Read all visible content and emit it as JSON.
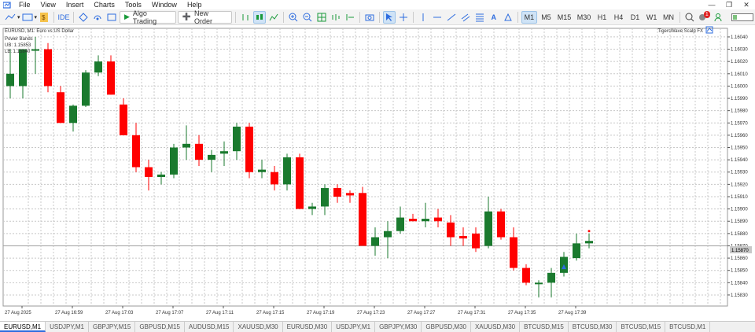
{
  "menu": {
    "items": [
      "File",
      "View",
      "Insert",
      "Charts",
      "Tools",
      "Window",
      "Help"
    ]
  },
  "toolbar": {
    "ide": "IDE",
    "algo_trading": "Algo Trading",
    "new_order": "New Order",
    "timeframes": [
      "M1",
      "M5",
      "M15",
      "M30",
      "H1",
      "H4",
      "D1",
      "W1",
      "MN"
    ],
    "active_timeframe": "M1",
    "notification_count": "1"
  },
  "chart": {
    "symbol_info": "EURUSD, M1:  Euro vs US Dollar",
    "indicator_name": "Power Bands",
    "indicator_ub": "UB: 1.15853",
    "indicator_lb": "LB: 1.15840",
    "ea_name": "TigersWave Scalp FX",
    "current_price": "1.15870",
    "colors": {
      "bull": "#1a7a2e",
      "bear": "#ff0000",
      "grid": "#c8c8c8",
      "ask_line": "#a0a0a0"
    }
  },
  "chart_data": {
    "type": "candlestick",
    "price_axis_labels": [
      "1.16040",
      "1.16030",
      "1.16020",
      "1.16010",
      "1.16000",
      "1.15990",
      "1.15980",
      "1.15970",
      "1.15960",
      "1.15950",
      "1.15940",
      "1.15930",
      "1.15920",
      "1.15910",
      "1.15900",
      "1.15890",
      "1.15880",
      "1.15870",
      "1.15860",
      "1.15850",
      "1.15840",
      "1.15830"
    ],
    "time_axis_labels": [
      "27 Aug 2025",
      "27 Aug 16:59",
      "27 Aug 17:03",
      "27 Aug 17:07",
      "27 Aug 17:11",
      "27 Aug 17:15",
      "27 Aug 17:19",
      "27 Aug 17:23",
      "27 Aug 17:27",
      "27 Aug 17:31",
      "27 Aug 17:35",
      "27 Aug 17:39"
    ],
    "ylim": [
      1.15821,
      1.16047
    ],
    "candles": [
      {
        "o": 1.16,
        "h": 1.1603,
        "l": 1.1599,
        "c": 1.1601
      },
      {
        "o": 1.16,
        "h": 1.1603,
        "l": 1.1599,
        "c": 1.1603
      },
      {
        "o": 1.1603,
        "h": 1.1604,
        "l": 1.1601,
        "c": 1.1603
      },
      {
        "o": 1.1603,
        "h": 1.16035,
        "l": 1.15995,
        "c": 1.16
      },
      {
        "o": 1.15995,
        "h": 1.16,
        "l": 1.1597,
        "c": 1.1597
      },
      {
        "o": 1.1597,
        "h": 1.15985,
        "l": 1.15963,
        "c": 1.15984
      },
      {
        "o": 1.15984,
        "h": 1.16013,
        "l": 1.15983,
        "c": 1.16011
      },
      {
        "o": 1.16011,
        "h": 1.16025,
        "l": 1.16008,
        "c": 1.1602
      },
      {
        "o": 1.1602,
        "h": 1.16025,
        "l": 1.15993,
        "c": 1.15993
      },
      {
        "o": 1.15985,
        "h": 1.1599,
        "l": 1.1596,
        "c": 1.1596
      },
      {
        "o": 1.1596,
        "h": 1.1597,
        "l": 1.1593,
        "c": 1.15934
      },
      {
        "o": 1.15934,
        "h": 1.1594,
        "l": 1.15915,
        "c": 1.15926
      },
      {
        "o": 1.15926,
        "h": 1.1593,
        "l": 1.1592,
        "c": 1.15928
      },
      {
        "o": 1.15928,
        "h": 1.15953,
        "l": 1.15925,
        "c": 1.1595
      },
      {
        "o": 1.1595,
        "h": 1.15968,
        "l": 1.1594,
        "c": 1.15953
      },
      {
        "o": 1.15953,
        "h": 1.1596,
        "l": 1.15935,
        "c": 1.1594
      },
      {
        "o": 1.1594,
        "h": 1.15948,
        "l": 1.1593,
        "c": 1.15944
      },
      {
        "o": 1.15945,
        "h": 1.15955,
        "l": 1.15935,
        "c": 1.15947
      },
      {
        "o": 1.15947,
        "h": 1.1597,
        "l": 1.1594,
        "c": 1.15967
      },
      {
        "o": 1.15967,
        "h": 1.1597,
        "l": 1.15925,
        "c": 1.1593
      },
      {
        "o": 1.1593,
        "h": 1.1594,
        "l": 1.15925,
        "c": 1.15932
      },
      {
        "o": 1.1593,
        "h": 1.15935,
        "l": 1.15915,
        "c": 1.1592
      },
      {
        "o": 1.1592,
        "h": 1.15945,
        "l": 1.15915,
        "c": 1.15942
      },
      {
        "o": 1.15942,
        "h": 1.15945,
        "l": 1.159,
        "c": 1.159
      },
      {
        "o": 1.159,
        "h": 1.15905,
        "l": 1.15895,
        "c": 1.15902
      },
      {
        "o": 1.15902,
        "h": 1.1592,
        "l": 1.15895,
        "c": 1.15917
      },
      {
        "o": 1.15917,
        "h": 1.1592,
        "l": 1.15905,
        "c": 1.1591
      },
      {
        "o": 1.15913,
        "h": 1.15915,
        "l": 1.15905,
        "c": 1.15911
      },
      {
        "o": 1.15913,
        "h": 1.15918,
        "l": 1.1589,
        "c": 1.1587
      },
      {
        "o": 1.1587,
        "h": 1.15885,
        "l": 1.15862,
        "c": 1.15877
      },
      {
        "o": 1.15877,
        "h": 1.1589,
        "l": 1.1586,
        "c": 1.15882
      },
      {
        "o": 1.15882,
        "h": 1.15902,
        "l": 1.1588,
        "c": 1.15893
      },
      {
        "o": 1.15892,
        "h": 1.15896,
        "l": 1.1589,
        "c": 1.1589
      },
      {
        "o": 1.1589,
        "h": 1.15905,
        "l": 1.15885,
        "c": 1.15892
      },
      {
        "o": 1.15893,
        "h": 1.159,
        "l": 1.15885,
        "c": 1.1589
      },
      {
        "o": 1.15889,
        "h": 1.15895,
        "l": 1.1587,
        "c": 1.15877
      },
      {
        "o": 1.15878,
        "h": 1.15885,
        "l": 1.1587,
        "c": 1.15876
      },
      {
        "o": 1.1588,
        "h": 1.15885,
        "l": 1.15865,
        "c": 1.15868
      },
      {
        "o": 1.1587,
        "h": 1.1591,
        "l": 1.15868,
        "c": 1.15898
      },
      {
        "o": 1.15898,
        "h": 1.159,
        "l": 1.15875,
        "c": 1.15877
      },
      {
        "o": 1.15877,
        "h": 1.15885,
        "l": 1.1585,
        "c": 1.15852
      },
      {
        "o": 1.15852,
        "h": 1.15855,
        "l": 1.15838,
        "c": 1.1584
      },
      {
        "o": 1.1584,
        "h": 1.15842,
        "l": 1.15828,
        "c": 1.1584
      },
      {
        "o": 1.1584,
        "h": 1.15852,
        "l": 1.15828,
        "c": 1.15848
      },
      {
        "o": 1.15848,
        "h": 1.15865,
        "l": 1.15845,
        "c": 1.15861
      },
      {
        "o": 1.1586,
        "h": 1.1588,
        "l": 1.15858,
        "c": 1.15872
      },
      {
        "o": 1.15872,
        "h": 1.1588,
        "l": 1.15868,
        "c": 1.15874
      }
    ]
  },
  "tabs": [
    "EURUSD,M1",
    "USDJPY,M1",
    "GBPJPY,M15",
    "GBPUSD,M15",
    "AUDUSD,M15",
    "XAUUSD,M30",
    "EURUSD,M30",
    "USDJPY,M1",
    "GBPJPY,M30",
    "GBPUSD,M30",
    "XAUUSD,M30",
    "BTCUSD,M15",
    "BTCUSD,M30",
    "BTCUSD,M15",
    "BTCUSD,M1"
  ]
}
